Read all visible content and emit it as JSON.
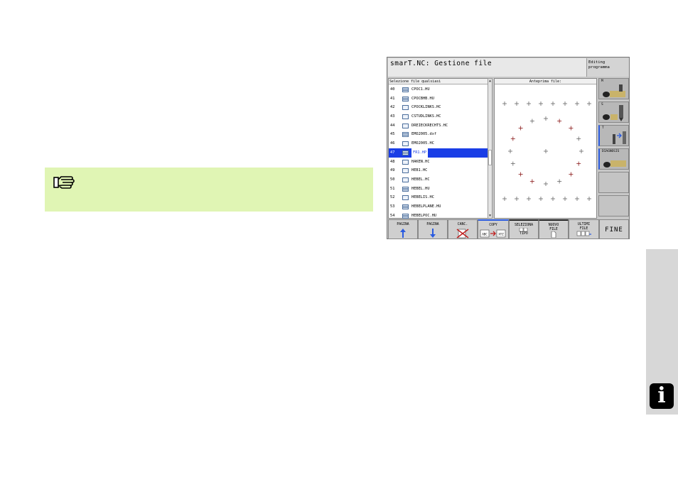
{
  "screen": {
    "title": "smarT.NC: Gestione file",
    "mode_line1": "Editing",
    "mode_line2": "programma",
    "list_header": "Selezione file qualsiasi",
    "preview_header": "Anteprima file:",
    "files": [
      {
        "num": "40",
        "name": "CPOC1.HU",
        "type": "hu",
        "selected": false
      },
      {
        "num": "41",
        "name": "CPOCBHB.HU",
        "type": "hu",
        "selected": false
      },
      {
        "num": "42",
        "name": "CPOCKLINKS.HC",
        "type": "hc",
        "selected": false
      },
      {
        "num": "43",
        "name": "CSTUDLINKS.HC",
        "type": "hc",
        "selected": false
      },
      {
        "num": "44",
        "name": "DREIECKRECHTS.HC",
        "type": "hc",
        "selected": false
      },
      {
        "num": "45",
        "name": "EMO2005.dxf",
        "type": "hu",
        "selected": false
      },
      {
        "num": "46",
        "name": "EMO2005.HC",
        "type": "hc",
        "selected": false
      },
      {
        "num": "47",
        "name": "FR1.HP",
        "type": "hu",
        "selected": true
      },
      {
        "num": "48",
        "name": "HAKEN.HC",
        "type": "hc",
        "selected": false
      },
      {
        "num": "49",
        "name": "HEB1.HC",
        "type": "hc",
        "selected": false
      },
      {
        "num": "50",
        "name": "HEBEL.HC",
        "type": "hc",
        "selected": false
      },
      {
        "num": "51",
        "name": "HEBEL.HU",
        "type": "hu",
        "selected": false
      },
      {
        "num": "52",
        "name": "HEBELIS.HC",
        "type": "hc",
        "selected": false
      },
      {
        "num": "53",
        "name": "HEBELPLANE.HU",
        "type": "hu",
        "selected": false
      },
      {
        "num": "54",
        "name": "HEBELPOC.HU",
        "type": "hu",
        "selected": false
      }
    ],
    "side_buttons": [
      {
        "label": "M"
      },
      {
        "label": "S"
      },
      {
        "label": "T"
      },
      {
        "label": "DIAGNOSIS"
      }
    ],
    "softkeys": [
      {
        "line1": "PAGINA",
        "line2": "",
        "icon": "arrow-up-icon"
      },
      {
        "line1": "PAGINA",
        "line2": "",
        "icon": "arrow-down-icon"
      },
      {
        "line1": "CANC.",
        "line2": "",
        "icon": "delete-x-icon"
      },
      {
        "line1": "COPY",
        "line2": "",
        "from": "ABC",
        "to": "XYZ",
        "icon": "copy-icon"
      },
      {
        "line1": "SELEZIONA",
        "line2": "TIPO",
        "icon": "file-type-icon"
      },
      {
        "line1": "NUOVO",
        "line2": "FILE",
        "icon": "new-file-icon"
      },
      {
        "line1": "ULTIMI",
        "line2": "FILE",
        "icon": "recent-files-icon"
      },
      {
        "line1": "FINE",
        "line2": "",
        "icon": ""
      }
    ]
  },
  "colors": {
    "note_bg": "#e0f5b4",
    "selection": "#1a3ee6",
    "marker_red": "#8b1a1a",
    "marker_gray": "#666666"
  }
}
